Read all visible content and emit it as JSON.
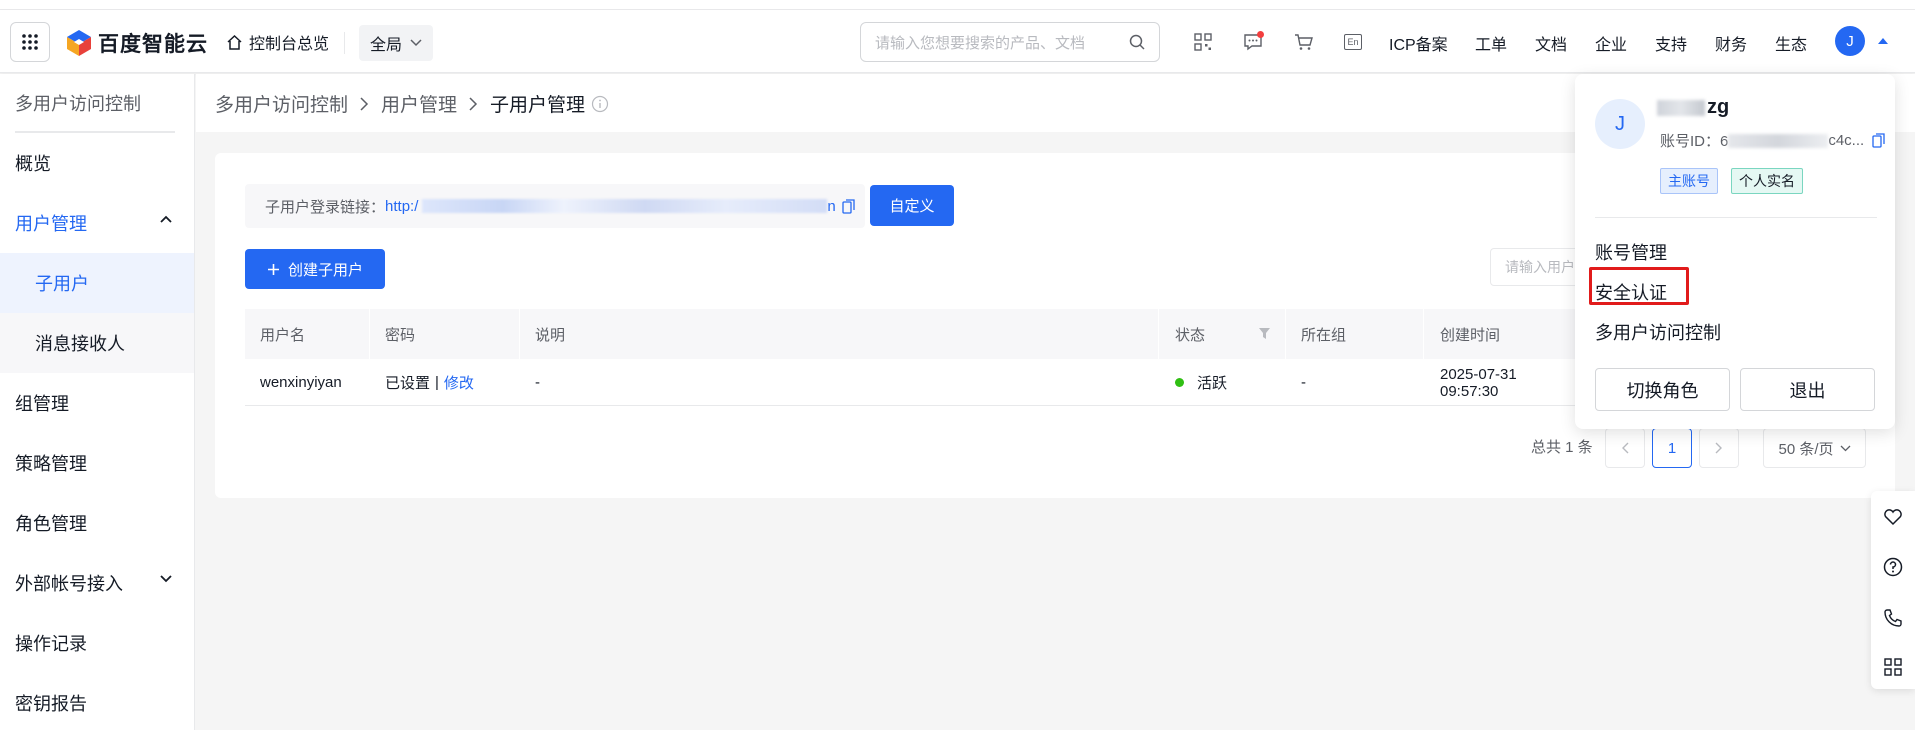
{
  "brand": {
    "name": "百度智能云"
  },
  "topnav": {
    "home": "控制台总览",
    "region": "全局",
    "search_placeholder": "请输入您想要搜索的产品、文档",
    "lang": "En",
    "links": [
      "ICP备案",
      "工单",
      "文档",
      "企业",
      "支持",
      "财务",
      "生态"
    ],
    "avatar_letter": "J"
  },
  "sidebar": {
    "title": "多用户访问控制",
    "items": [
      {
        "label": "概览"
      },
      {
        "label": "用户管理"
      },
      {
        "label": "子用户"
      },
      {
        "label": "消息接收人"
      },
      {
        "label": "组管理"
      },
      {
        "label": "策略管理"
      },
      {
        "label": "角色管理"
      },
      {
        "label": "外部帐号接入"
      },
      {
        "label": "操作记录"
      },
      {
        "label": "密钥报告"
      }
    ]
  },
  "breadcrumb": [
    "多用户访问控制",
    "用户管理",
    "子用户管理"
  ],
  "main": {
    "login_link_label": "子用户登录链接：",
    "login_link_prefix": "http:/",
    "login_link_suffix": "n",
    "customize_button": "自定义",
    "create_button": "创建子用户",
    "search_placeholder": "请输入用户"
  },
  "table": {
    "columns": [
      "用户名",
      "密码",
      "说明",
      "状态",
      "所在组",
      "创建时间"
    ],
    "rows": [
      {
        "username": "wenxinyiyan",
        "password_set": "已设置",
        "sep": "|",
        "password_edit": "修改",
        "desc": "-",
        "status": "活跃",
        "group": "-",
        "created": "2025-07-31 09:57:30"
      }
    ]
  },
  "pagination": {
    "total": "总共 1 条",
    "current": "1",
    "page_size": "50 条/页"
  },
  "account_dropdown": {
    "avatar_letter": "J",
    "name_suffix": "zg",
    "id_label": "账号ID：6",
    "id_suffix": "c4c...",
    "tags": [
      "主账号",
      "个人实名"
    ],
    "menu": [
      "账号管理",
      "安全认证",
      "多用户访问控制"
    ],
    "switch_role": "切换角色",
    "logout": "退出"
  },
  "colors": {
    "primary": "#2468f2",
    "active_status": "#30bf13",
    "highlight": "#e11b1b",
    "notice_dot": "#f33e3e"
  }
}
